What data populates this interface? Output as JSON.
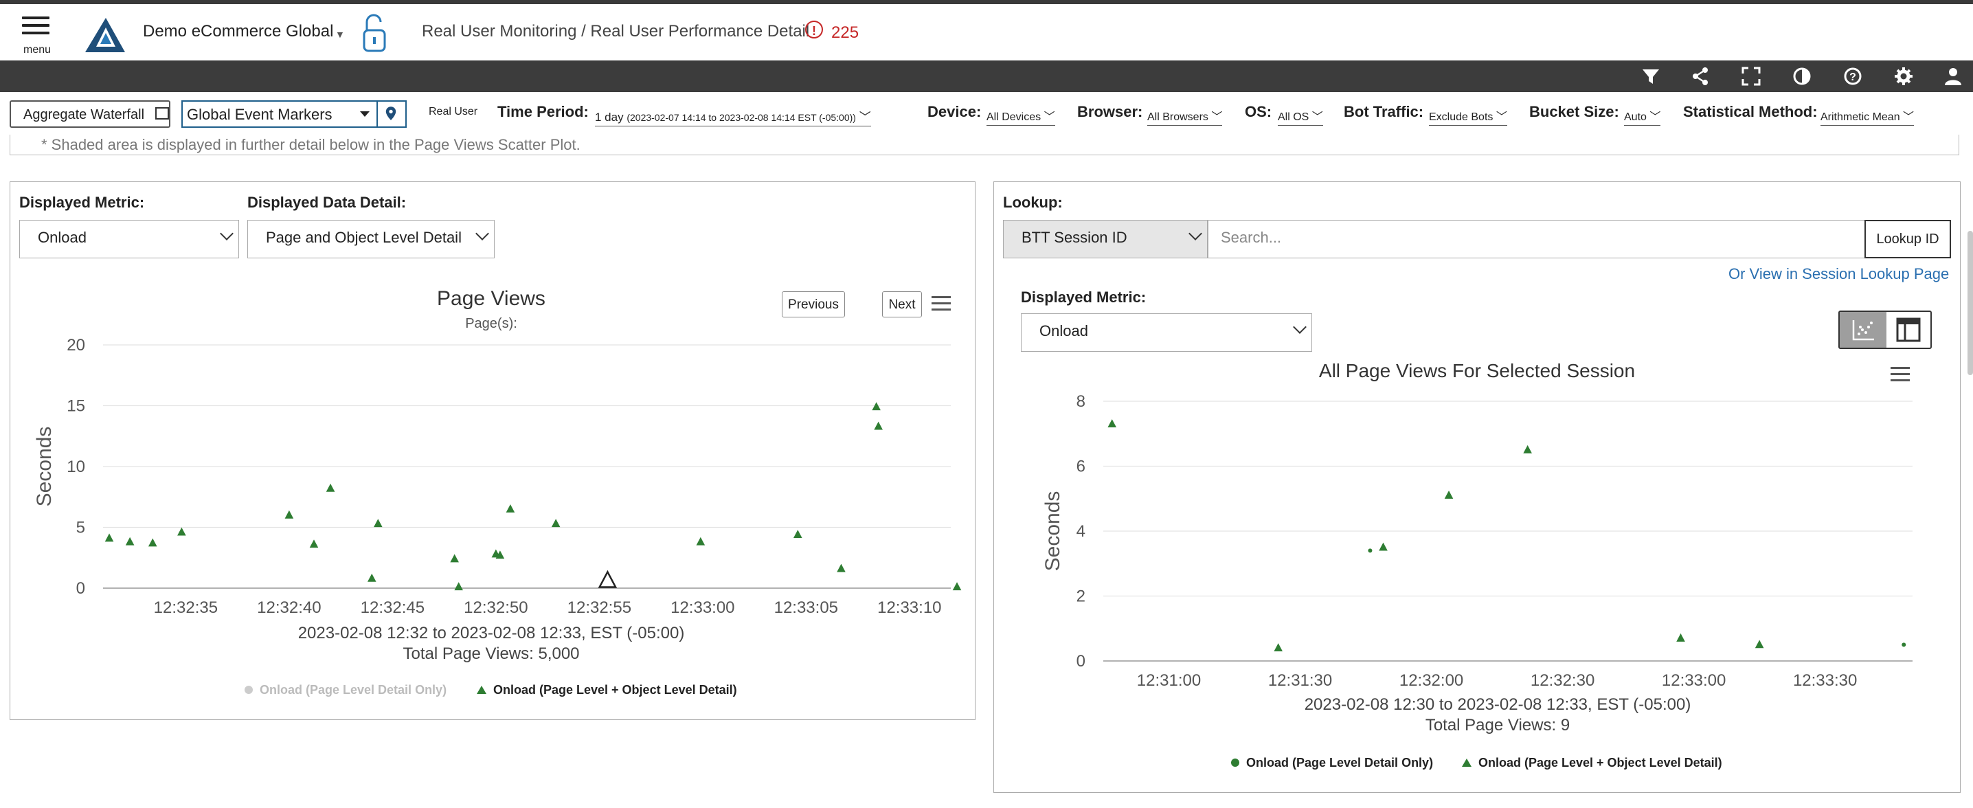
{
  "header": {
    "menu_label": "menu",
    "app_name": "Demo eCommerce Global",
    "breadcrumb": "Real User Monitoring / Real User Performance Detail",
    "alert_count": "225"
  },
  "toolbar": {
    "icons": [
      "filter-icon",
      "share-icon",
      "fullscreen-icon",
      "contrast-icon",
      "help-icon",
      "gear-icon",
      "user-icon"
    ]
  },
  "filters": {
    "aggregate_waterfall": "Aggregate Waterfall",
    "event_markers": "Global Event Markers",
    "real_user": "Real User",
    "time_period_label": "Time Period:",
    "time_period_value": "1 day",
    "time_period_range": "(2023-02-07 14:14 to 2023-02-08 14:14 EST (-05:00))",
    "device_label": "Device:",
    "device_value": "All Devices",
    "browser_label": "Browser:",
    "browser_value": "All Browsers",
    "os_label": "OS:",
    "os_value": "All OS",
    "bot_label": "Bot Traffic:",
    "bot_value": "Exclude Bots",
    "bucket_label": "Bucket Size:",
    "bucket_value": "Auto",
    "stat_label": "Statistical Method:",
    "stat_value": "Arithmetic Mean"
  },
  "note": "* Shaded area is displayed in further detail below in the Page Views Scatter Plot.",
  "left_panel": {
    "metric_label": "Displayed Metric:",
    "metric_value": "Onload",
    "detail_label": "Displayed Data Detail:",
    "detail_value": "Page and Object Level Detail",
    "previous": "Previous",
    "next": "Next",
    "footer_range": "2023-02-08 12:32 to 2023-02-08 12:33, EST (-05:00)",
    "footer_total": "Total Page Views: 5,000",
    "legend_1": "Onload (Page Level Detail Only)",
    "legend_2": "Onload (Page Level + Object Level Detail)"
  },
  "right_panel": {
    "lookup_label": "Lookup:",
    "lookup_type": "BTT Session ID",
    "search_placeholder": "Search...",
    "lookup_button": "Lookup ID",
    "session_link": "Or View in Session Lookup Page",
    "metric_label": "Displayed Metric:",
    "metric_value": "Onload",
    "footer_range": "2023-02-08 12:30 to 2023-02-08 12:33, EST (-05:00)",
    "footer_total": "Total Page Views: 9",
    "legend_1": "Onload (Page Level Detail Only)",
    "legend_2": "Onload (Page Level + Object Level Detail)"
  },
  "chart_data": [
    {
      "type": "scatter",
      "title": "Page Views",
      "subtitle": "Page(s):",
      "ylabel": "Seconds",
      "ylim": [
        0,
        20
      ],
      "yticks": [
        0,
        5,
        10,
        15,
        20
      ],
      "xlim": [
        "12:32:31",
        "12:33:12"
      ],
      "xticks": [
        "12:32:35",
        "12:32:40",
        "12:32:45",
        "12:32:50",
        "12:32:55",
        "12:33:00",
        "12:33:05",
        "12:33:10"
      ],
      "grid": true,
      "series": [
        {
          "name": "Onload (Page Level Detail Only)",
          "color": "#cccccc",
          "points": []
        },
        {
          "name": "Onload (Page Level + Object Level Detail)",
          "color": "#2e7d32",
          "points": [
            {
              "x": "12:32:31.3",
              "y": 4.1
            },
            {
              "x": "12:32:32.3",
              "y": 3.8
            },
            {
              "x": "12:32:33.4",
              "y": 3.7
            },
            {
              "x": "12:32:34.8",
              "y": 4.6
            },
            {
              "x": "12:32:40.0",
              "y": 6.0
            },
            {
              "x": "12:32:41.2",
              "y": 3.6
            },
            {
              "x": "12:32:42.0",
              "y": 8.2
            },
            {
              "x": "12:32:44.0",
              "y": 0.8
            },
            {
              "x": "12:32:44.3",
              "y": 5.3
            },
            {
              "x": "12:32:48.0",
              "y": 2.4
            },
            {
              "x": "12:32:48.2",
              "y": 0.1
            },
            {
              "x": "12:32:50.0",
              "y": 2.8
            },
            {
              "x": "12:32:50.2",
              "y": 2.7
            },
            {
              "x": "12:32:50.7",
              "y": 6.5
            },
            {
              "x": "12:32:52.9",
              "y": 5.3
            },
            {
              "x": "12:32:59.9",
              "y": 3.8
            },
            {
              "x": "12:33:04.6",
              "y": 4.4
            },
            {
              "x": "12:33:06.7",
              "y": 1.6
            },
            {
              "x": "12:33:08.4",
              "y": 14.9
            },
            {
              "x": "12:33:08.5",
              "y": 13.3
            },
            {
              "x": "12:33:12.3",
              "y": 0.1
            }
          ]
        }
      ],
      "marker": {
        "x": "12:32:55.4",
        "y": 0.6
      }
    },
    {
      "type": "scatter",
      "title": "All Page Views For Selected Session",
      "ylabel": "Seconds",
      "ylim": [
        0,
        8
      ],
      "yticks": [
        0,
        2,
        4,
        6,
        8
      ],
      "xlim": [
        "12:30:45",
        "12:33:50"
      ],
      "xticks": [
        "12:31:00",
        "12:31:30",
        "12:32:00",
        "12:32:30",
        "12:33:00",
        "12:33:30"
      ],
      "grid": true,
      "series": [
        {
          "name": "Onload (Page Level Detail Only)",
          "color": "#2e7d32",
          "points": [
            {
              "x": "12:31:46",
              "y": 3.4
            },
            {
              "x": "12:33:48",
              "y": 0.5
            }
          ]
        },
        {
          "name": "Onload (Page Level + Object Level Detail)",
          "color": "#2e7d32",
          "points": [
            {
              "x": "12:30:47",
              "y": 7.3
            },
            {
              "x": "12:31:25",
              "y": 0.4
            },
            {
              "x": "12:31:49",
              "y": 3.5
            },
            {
              "x": "12:32:04",
              "y": 5.1
            },
            {
              "x": "12:32:22",
              "y": 6.5
            },
            {
              "x": "12:32:57",
              "y": 0.7
            },
            {
              "x": "12:33:15",
              "y": 0.5
            }
          ]
        }
      ]
    }
  ]
}
